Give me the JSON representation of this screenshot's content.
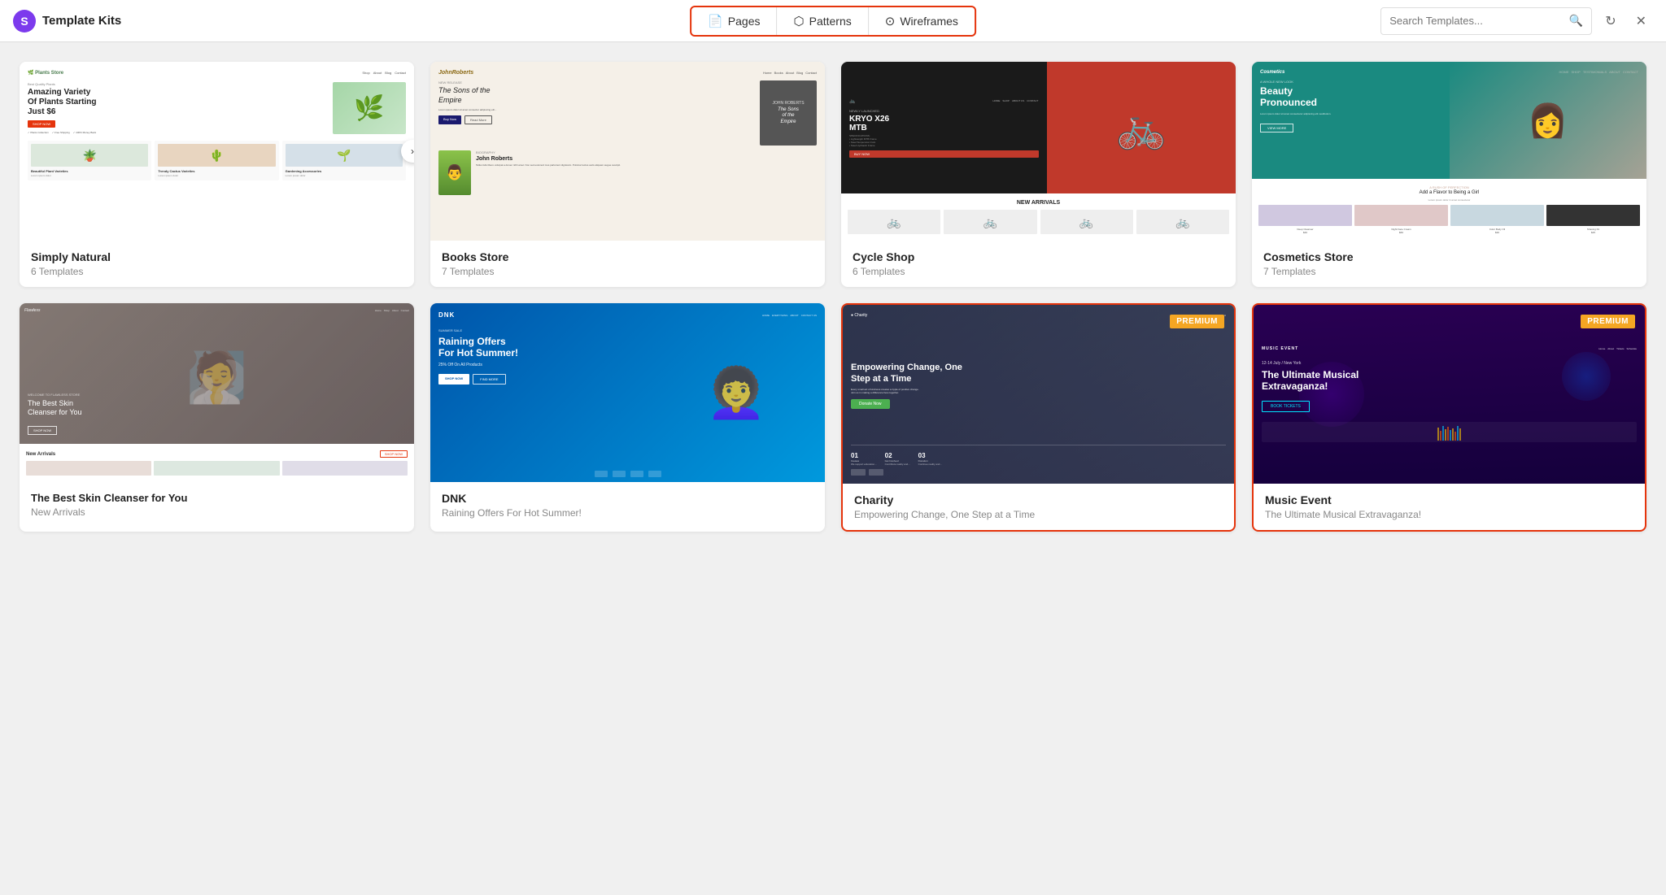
{
  "app": {
    "logo_letter": "S",
    "logo_text": "Template Kits"
  },
  "header": {
    "tabs": [
      {
        "id": "pages",
        "label": "Pages",
        "icon": "📄"
      },
      {
        "id": "patterns",
        "label": "Patterns",
        "icon": "🔶"
      },
      {
        "id": "wireframes",
        "label": "Wireframes",
        "icon": "⊙"
      }
    ],
    "search_placeholder": "Search Templates...",
    "refresh_title": "Refresh",
    "close_title": "Close"
  },
  "templates": [
    {
      "id": "simply-natural",
      "title": "Simply Natural",
      "meta": "6 Templates",
      "premium": false,
      "highlighted": false
    },
    {
      "id": "books-store",
      "title": "Books Store",
      "meta": "7 Templates",
      "premium": false,
      "highlighted": false
    },
    {
      "id": "cycle-shop",
      "title": "Cycle Shop",
      "meta": "6 Templates",
      "premium": false,
      "highlighted": false
    },
    {
      "id": "cosmetics-store",
      "title": "Cosmetics Store",
      "meta": "7 Templates",
      "premium": false,
      "highlighted": false
    },
    {
      "id": "flawless",
      "title": "The Best Skin Cleanser for You",
      "meta": "New Arrivals",
      "premium": false,
      "highlighted": false
    },
    {
      "id": "dnk",
      "title": "DNK",
      "meta": "Raining Offers For Hot Summer!",
      "premium": false,
      "highlighted": false
    },
    {
      "id": "charity",
      "title": "Charity",
      "meta": "Empowering Change, One Step at a Time",
      "premium": true,
      "highlighted": true
    },
    {
      "id": "music-event",
      "title": "Music Event",
      "meta": "The Ultimate Musical Extravaganza!",
      "premium": true,
      "highlighted": true
    }
  ],
  "premium_label": "PREMIUM"
}
